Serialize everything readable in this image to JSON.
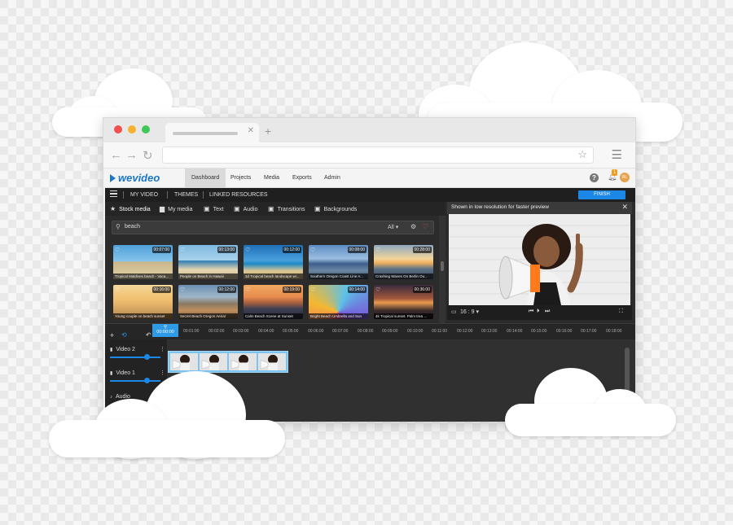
{
  "app": {
    "brand": "wevideo",
    "nav": [
      "Dashboard",
      "Projects",
      "Media",
      "Exports",
      "Admin"
    ],
    "active_nav": "Dashboard",
    "notification_count": "1",
    "avatar_initials": "RL"
  },
  "subnav": {
    "items": [
      "MY VIDEO",
      "THEMES",
      "LINKED RESOURCES"
    ],
    "finish_label": "FINISH"
  },
  "media_tabs": [
    {
      "label": "Stock media",
      "icon": "star-icon"
    },
    {
      "label": "My media",
      "icon": "folder-icon"
    },
    {
      "label": "Text",
      "icon": "text-icon"
    },
    {
      "label": "Audio",
      "icon": "audio-icon"
    },
    {
      "label": "Transitions",
      "icon": "transitions-icon"
    },
    {
      "label": "Backgrounds",
      "icon": "backgrounds-icon"
    }
  ],
  "search": {
    "value": "beach",
    "filter": "All"
  },
  "thumbnails": [
    {
      "duration": "00:07:00",
      "caption": "Tropical Maldives beach - Vaca..."
    },
    {
      "duration": "00:13:00",
      "caption": "People on Beach in Hawaii"
    },
    {
      "duration": "00:12:00",
      "caption": "3d Tropical beach landscape wi..."
    },
    {
      "duration": "00:08:00",
      "caption": "Southern Oregon Coast Line A..."
    },
    {
      "duration": "00:28:00",
      "caption": "Crashing Waves On Berlin Ou..."
    },
    {
      "duration": "00:16:00",
      "caption": "Young couple on beach sunset"
    },
    {
      "duration": "00:12:00",
      "caption": "Secret Beach Oregon Aerial"
    },
    {
      "duration": "00:19:00",
      "caption": "Calm Beach Scene at Sunset"
    },
    {
      "duration": "00:14:00",
      "caption": "Bright Beach Umbrella and Sun"
    },
    {
      "duration": "00:36:00",
      "caption": "4k Tropical sunset. Palm trea ..."
    }
  ],
  "preview": {
    "title": "Shown in low resolution for faster preview",
    "aspect": "16 : 9"
  },
  "timeline": {
    "playhead": "00:00:00",
    "ticks": [
      "00:01:00",
      "00:02:00",
      "00:03:00",
      "00:04:00",
      "00:05:00",
      "00:06:00",
      "00:07:00",
      "00:08:00",
      "00:09:00",
      "00:10:00",
      "00:11:00",
      "00:12:00",
      "00:13:00",
      "00:14:00",
      "00:15:00",
      "00:16:00",
      "00:17:00",
      "00:18:00"
    ],
    "tracks": [
      {
        "label": "Video 2",
        "icon": "video-track-icon"
      },
      {
        "label": "Video 1",
        "icon": "video-track-icon"
      },
      {
        "label": "Audio",
        "icon": "music-note-icon"
      }
    ]
  },
  "colors": {
    "brand": "#1b76c8",
    "finish": "#1b87e6",
    "playhead": "#2d9be5",
    "clip": "#7dc3f0"
  }
}
